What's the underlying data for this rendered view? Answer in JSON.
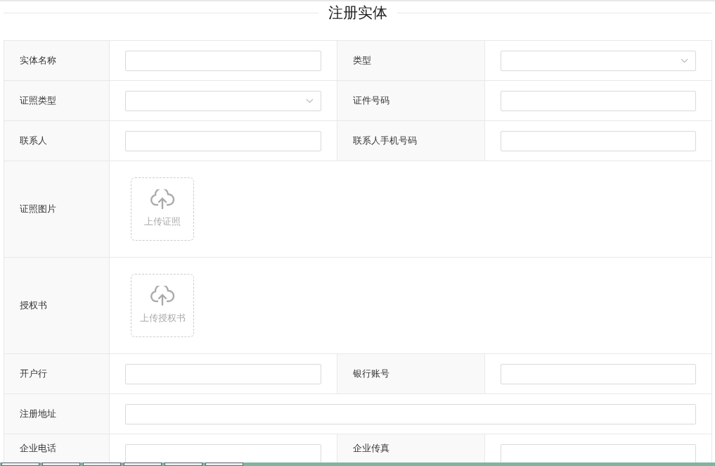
{
  "title": "注册实体",
  "rows": [
    {
      "kind": "pair",
      "fields": [
        {
          "label": "实体名称",
          "kind": "text"
        },
        {
          "label": "类型",
          "kind": "select"
        }
      ]
    },
    {
      "kind": "pair",
      "fields": [
        {
          "label": "证照类型",
          "kind": "select"
        },
        {
          "label": "证件号码",
          "kind": "text"
        }
      ]
    },
    {
      "kind": "pair",
      "fields": [
        {
          "label": "联系人",
          "kind": "text"
        },
        {
          "label": "联系人手机号码",
          "kind": "text"
        }
      ]
    },
    {
      "kind": "upload",
      "label": "证照图片",
      "button": "上传证照"
    },
    {
      "kind": "upload",
      "label": "授权书",
      "button": "上传授权书"
    },
    {
      "kind": "pair",
      "fields": [
        {
          "label": "开户行",
          "kind": "text"
        },
        {
          "label": "银行账号",
          "kind": "text"
        }
      ]
    },
    {
      "kind": "wide",
      "label": "注册地址"
    },
    {
      "kind": "pair",
      "fields": [
        {
          "label": "企业电话",
          "kind": "text"
        },
        {
          "label": "企业传真",
          "kind": "text"
        }
      ]
    }
  ]
}
